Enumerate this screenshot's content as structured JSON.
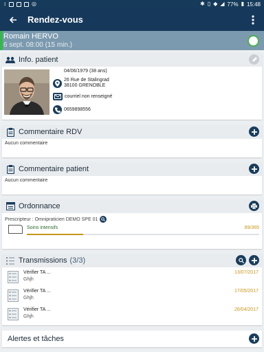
{
  "status_bar": {
    "battery": "77%",
    "time": "15:48"
  },
  "app_bar": {
    "title": "Rendez-vous"
  },
  "appointment": {
    "patient_name": "Romain HERVO",
    "datetime": "6 sept. 08:00 (15 min.)"
  },
  "patient_info": {
    "title": "Info. patient",
    "birthdate": "04/06/1979 (38 ans)",
    "address_line1": "26 Rue de Stalingrad",
    "address_line2": "38100 GRENOBLE",
    "email": "courriel non renseigné",
    "phone": "0659898556"
  },
  "comment_rdv": {
    "title": "Commentaire RDV",
    "text": "Aucun commentaire"
  },
  "comment_patient": {
    "title": "Commentaire patient",
    "text": "Aucun commentaire"
  },
  "ordonnance": {
    "title": "Ordonnance",
    "prescripteur": "Prescripteur : Omnipraticien DEMO SPE 01",
    "soin_label": "Soins intensifs",
    "soin_count": "89/365",
    "progress_fraction": 0.244
  },
  "transmissions": {
    "title": "Transmissions",
    "count": "(3/3)",
    "items": [
      {
        "title": "Vérifier TA ...",
        "subtitle": "Ghjh",
        "date": "13/07/2017"
      },
      {
        "title": "Vérifier TA ...",
        "subtitle": "Ghjh",
        "date": "17/05/2017"
      },
      {
        "title": "Vérifier TA ...",
        "subtitle": "Ghjh",
        "date": "26/04/2017"
      }
    ]
  },
  "alertes": {
    "title": "Alertes et tâches"
  },
  "colors": {
    "primary": "#16395b",
    "patient_bar": "#7b9aaf",
    "accent_green": "#35b84a",
    "date_gold": "#c7961a"
  }
}
